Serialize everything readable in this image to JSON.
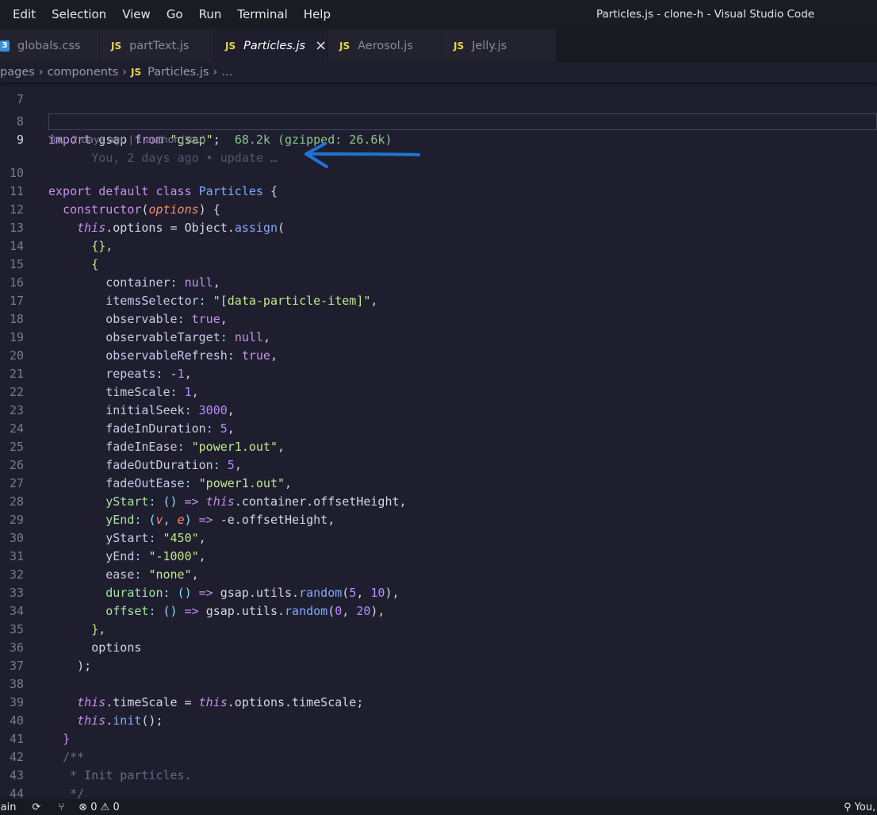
{
  "menu": [
    "Edit",
    "Selection",
    "View",
    "Go",
    "Run",
    "Terminal",
    "Help"
  ],
  "window_title": "Particles.js - clone-h - Visual Studio Code",
  "tabs": [
    {
      "label": "globals.css",
      "icon": "css-icon",
      "active": false
    },
    {
      "label": "partText.js",
      "icon": "js-icon",
      "active": false
    },
    {
      "label": "Particles.js",
      "icon": "js-icon",
      "active": true
    },
    {
      "label": "Aerosol.js",
      "icon": "js-icon",
      "active": false
    },
    {
      "label": "Jelly.js",
      "icon": "js-icon",
      "active": false
    }
  ],
  "breadcrumb": {
    "items": [
      "pages",
      "components"
    ],
    "file": "Particles.js",
    "more": "..."
  },
  "editor": {
    "current_line": 9,
    "line_7": "7",
    "import_size_hint": "68.2k (gzipped: 26.6k)",
    "inline_blame": "You, 2 days ago • update …",
    "codelens": "You, 2 days ago | 1 author (You)"
  },
  "statusbar": {
    "branch": "main",
    "errors": "0",
    "warnings": "0",
    "blame": "You,"
  },
  "colors": {
    "arrow": "#1f74d4",
    "js": "#e8d44d",
    "css": "#3c8fe0"
  }
}
